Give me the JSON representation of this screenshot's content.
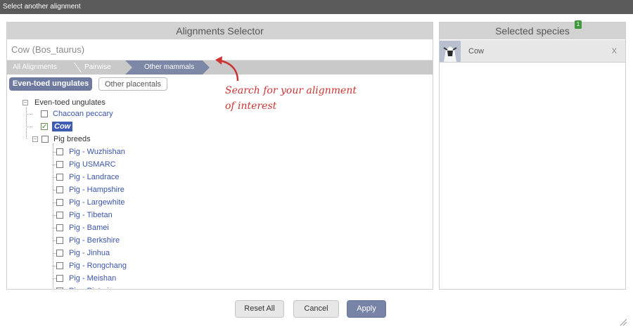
{
  "window": {
    "title": "Select another alignment"
  },
  "left_panel": {
    "title": "Alignments Selector",
    "search_value": "Cow (Bos_taurus)",
    "breadcrumb": [
      "All Alignments",
      "Pairwise",
      "Other mammals"
    ],
    "tabs": [
      "Even-toed ungulates",
      "Other placentals"
    ]
  },
  "tree": {
    "root": "Even-toed ungulates",
    "items": [
      {
        "label": "Chacoan peccary",
        "checked": false
      },
      {
        "label": "Cow",
        "checked": true
      },
      {
        "label": "Pig breeds",
        "checked": false
      }
    ],
    "pig_breeds": [
      "Pig - Wuzhishan",
      "Pig USMARC",
      "Pig - Landrace",
      "Pig - Hampshire",
      "Pig - Largewhite",
      "Pig - Tibetan",
      "Pig - Bamei",
      "Pig - Berkshire",
      "Pig - Jinhua",
      "Pig - Rongchang",
      "Pig - Meishan",
      "Pig - Pietrain"
    ]
  },
  "annotation": {
    "line1": "Search for your alignment",
    "line2": "of interest"
  },
  "right_panel": {
    "title": "Selected species",
    "badge_count": "1",
    "selected": [
      {
        "name": "Cow",
        "remove": "X"
      }
    ]
  },
  "buttons": {
    "reset": "Reset All",
    "cancel": "Cancel",
    "apply": "Apply"
  },
  "colors": {
    "accent": "#6f7aa0",
    "annotation": "#cc3333",
    "link": "#3a55a8"
  }
}
